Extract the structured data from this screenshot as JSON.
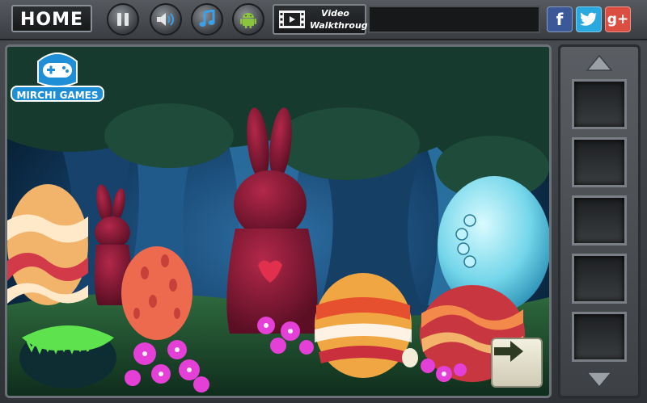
{
  "toolbar": {
    "home_label": "HOME",
    "video_line1": "Video",
    "video_line2": "Walkthrough",
    "buttons": [
      "pause-icon",
      "speaker-icon",
      "music-note-icon",
      "android-icon"
    ]
  },
  "social": {
    "facebook": "f",
    "twitter": "t",
    "google_plus": "g+"
  },
  "brand": {
    "logo_text": "MIRCHI GAMES"
  },
  "inventory": {
    "slot_count": 5
  },
  "colors": {
    "accent": "#1e8fd6",
    "facebook": "#3b5998",
    "twitter": "#2aa9e0",
    "google": "#dc4e41",
    "scene_dark": "#0d2a3a"
  }
}
